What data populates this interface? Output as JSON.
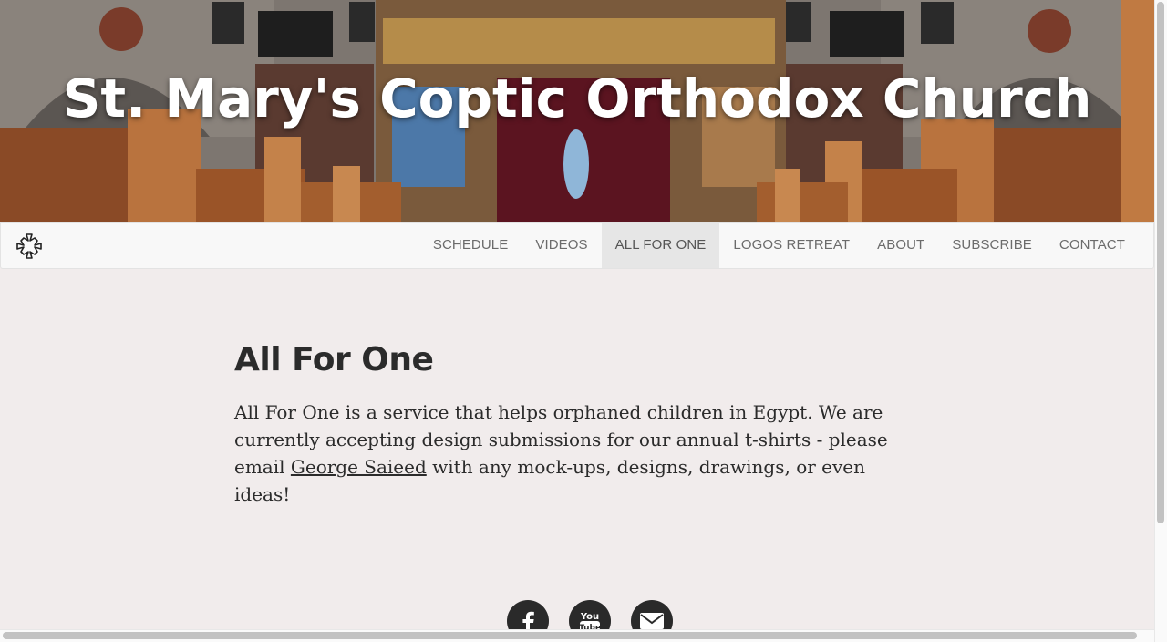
{
  "hero": {
    "title": "St. Mary's Coptic Orthodox Church"
  },
  "navbar": {
    "brand_icon": "coptic-cross-icon",
    "items": [
      {
        "label": "SCHEDULE",
        "active": false
      },
      {
        "label": "VIDEOS",
        "active": false
      },
      {
        "label": "ALL FOR ONE",
        "active": true
      },
      {
        "label": "LOGOS RETREAT",
        "active": false
      },
      {
        "label": "ABOUT",
        "active": false
      },
      {
        "label": "SUBSCRIBE",
        "active": false
      },
      {
        "label": "CONTACT",
        "active": false
      }
    ]
  },
  "main": {
    "title": "All For One",
    "paragraph_before": "All For One is a service that helps orphaned children in Egypt. We are currently accepting design submissions for our annual t-shirts - please email ",
    "link_text": "George Saieed",
    "paragraph_after": " with any mock-ups, designs, drawings, or even ideas!"
  },
  "social": {
    "icons": [
      "facebook-icon",
      "youtube-icon",
      "email-icon"
    ],
    "youtube_text": "You Tube"
  },
  "colors": {
    "page_bg": "#f1ecec",
    "navbar_bg": "#f8f8f8",
    "active_nav_bg": "#e6e6e6",
    "text": "#2b2b2b",
    "social_bg": "#2a2a2a"
  }
}
